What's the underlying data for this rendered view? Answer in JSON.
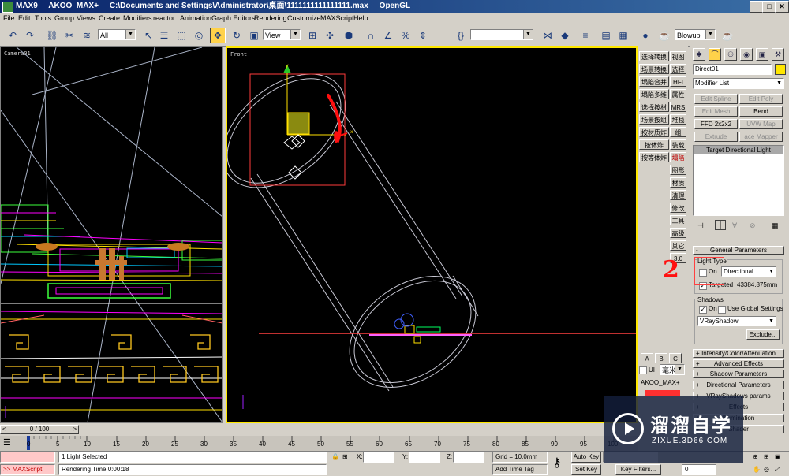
{
  "window": {
    "title": "MAX9     AKOO_MAX+     C:\\Documents and Settings\\Administrator\\桌面\\1111111111111111.max     OpenGL",
    "minimize": "_",
    "maximize": "□",
    "close": "✕"
  },
  "menu": [
    "File",
    "Edit",
    "Tools",
    "Group",
    "Views",
    "Create",
    "Modifiers",
    "reactor",
    "Animation",
    "Graph Editors",
    "Rendering",
    "Customize",
    "MAXScript",
    "Help"
  ],
  "toolbar": {
    "selection_filter": "All",
    "coord_system": "View",
    "named_selection": "",
    "render_type": "Blowup",
    "icons": [
      "undo-icon",
      "redo-icon",
      "select-link-icon",
      "unlink-icon",
      "bind-space-warp-icon",
      "select-object-icon",
      "select-by-name-icon",
      "rect-region-icon",
      "window-crossing-icon",
      "select-move-icon",
      "select-rotate-icon",
      "select-scale-icon",
      "pivot-icon",
      "manipulate-icon",
      "snap-icon",
      "angle-snap-icon",
      "percent-snap-icon",
      "spinner-snap-icon",
      "edit-named-sel-icon",
      "mirror-icon",
      "align-icon",
      "layer-manager-icon",
      "curve-editor-icon",
      "schematic-view-icon",
      "material-editor-icon",
      "render-scene-icon",
      "quick-render-icon"
    ]
  },
  "viewports": {
    "camera_label": "Camera01",
    "front_label": "Front"
  },
  "cn_buttons": {
    "left": [
      "选择转换",
      "场景转换",
      "塌陷合并",
      "塌陷多维",
      "选择按材",
      "场景按组",
      "按材质炸",
      "按体炸",
      "按等体炸"
    ],
    "right": [
      "视图",
      "选择",
      "HFI",
      "属性",
      "MRS",
      "堆栈",
      "组",
      "装载",
      "塌陷",
      "图形",
      "材质",
      "清理",
      "修改",
      "工具",
      "高级",
      "其它",
      "3.0"
    ],
    "abc": [
      "A",
      "B",
      "C"
    ],
    "ui_label": "UI",
    "unit": "毫米",
    "akoo": "AKOO_MAX+"
  },
  "command_panel": {
    "tab_icons": [
      "create-tab-icon",
      "modify-tab-icon",
      "hierarchy-tab-icon",
      "motion-tab-icon",
      "display-tab-icon",
      "utilities-tab-icon"
    ],
    "object_name": "Direct01",
    "object_color": "#ffe600",
    "modifier_list": "Modifier List",
    "modifier_buttons": [
      {
        "label": "Edit Spline",
        "enabled": false
      },
      {
        "label": "Edit Poly",
        "enabled": false
      },
      {
        "label": "Edit Mesh",
        "enabled": false
      },
      {
        "label": "Bend",
        "enabled": true
      },
      {
        "label": "FFD 2x2x2",
        "enabled": true
      },
      {
        "label": "UVW Map",
        "enabled": false
      },
      {
        "label": "Extrude",
        "enabled": false
      },
      {
        "label": "ace Mapper (W",
        "enabled": false
      }
    ],
    "stack_item": "Target Directional Light",
    "general_params": "General Parameters",
    "light_type_label": "Light Type",
    "on_label": "On",
    "light_type": "Directional",
    "targeted_label": "Targeted",
    "targeted_distance": "43384.875mm",
    "shadows_label": "Shadows",
    "shadows_on_label": "On",
    "use_global_label": "Use Global Settings",
    "shadow_type": "VRayShadow",
    "exclude_button": "Exclude...",
    "rollouts": [
      "Intensity/Color/Attenuation",
      "Advanced Effects",
      "Shadow Parameters",
      "Directional Parameters",
      "VRayShadows params",
      "Effects",
      "Illumination",
      "Shader"
    ]
  },
  "timeline": {
    "frame_display": "0 / 100",
    "ticks": [
      "0",
      "5",
      "10",
      "15",
      "20",
      "25",
      "30",
      "35",
      "40",
      "45",
      "50",
      "55",
      "60",
      "65",
      "70",
      "75",
      "80",
      "85",
      "90",
      "95",
      "100"
    ]
  },
  "status": {
    "maxscript": ">> MAXScript",
    "selected": "1 Light Selected",
    "render_time": "Rendering Time  0:00:18",
    "x_label": "X:",
    "y_label": "Y:",
    "z_label": "Z:",
    "grid": "Grid = 10.0mm",
    "add_time_tag": "Add Time Tag",
    "auto_key": "Auto Key",
    "set_key": "Set Key",
    "key_filters": "Key Filters...",
    "frame_field": "0"
  },
  "annotation_number": "2",
  "watermark": {
    "title": "溜溜自学",
    "url": "ZIXUE.3D66.COM"
  }
}
